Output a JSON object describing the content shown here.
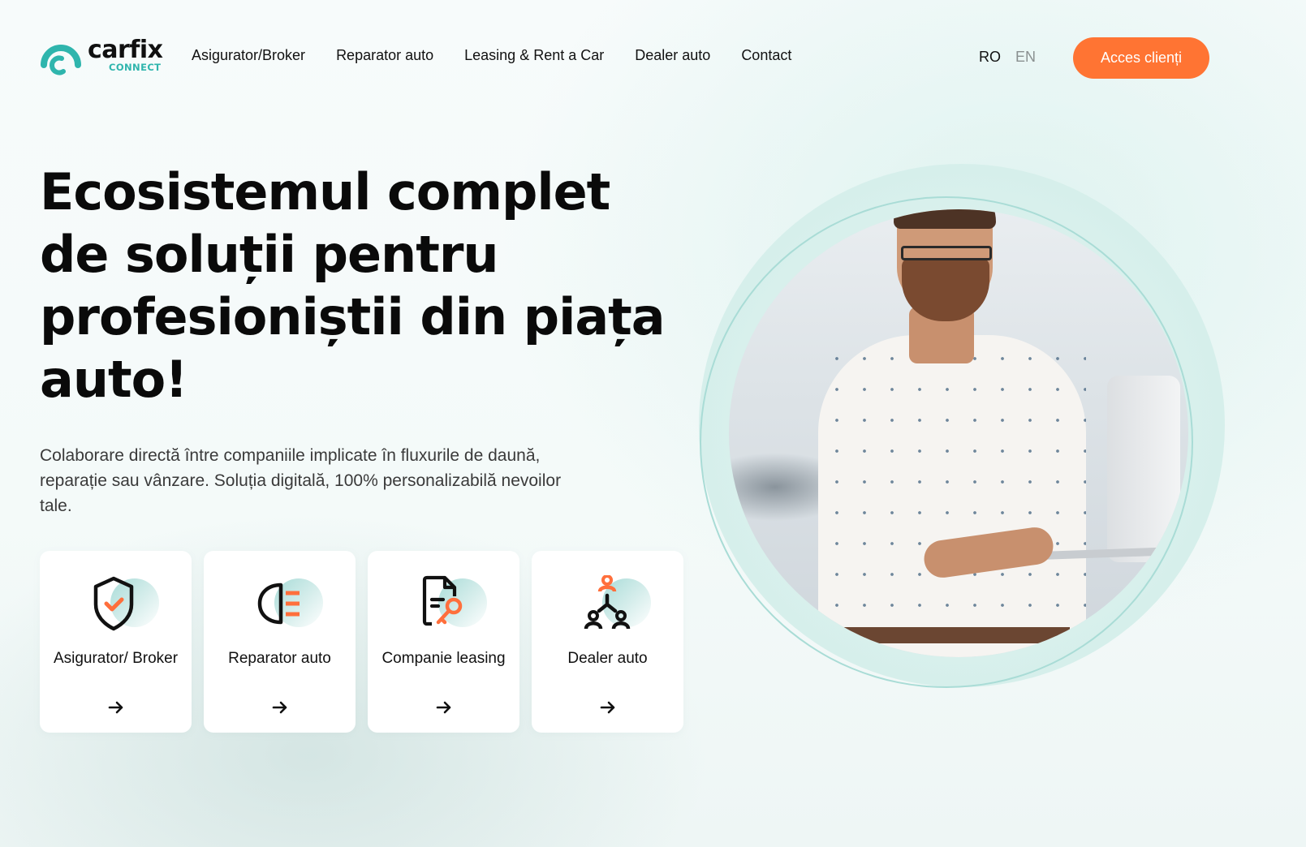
{
  "brand": {
    "name": "carfix",
    "subtitle": "CONNECT",
    "accent_color": "#2fb5ad",
    "cta_color": "#ff7433"
  },
  "nav": {
    "items": [
      {
        "label": "Asigurator/Broker"
      },
      {
        "label": "Reparator auto"
      },
      {
        "label": "Leasing & Rent a Car"
      },
      {
        "label": "Dealer auto"
      },
      {
        "label": "Contact"
      }
    ]
  },
  "language": {
    "options": [
      "RO",
      "EN"
    ],
    "selected": "RO"
  },
  "header": {
    "cta_label": "Acces clienți"
  },
  "hero": {
    "title": "Ecosistemul complet de soluții pentru profesioniștii din piața auto!",
    "subtitle": "Colaborare directă între companiile implicate în fluxurile de daună, reparație sau vânzare. Soluția digitală, 100% personalizabilă nevoilor tale.",
    "image_alt": "man-holding-laptop-portrait"
  },
  "cards": [
    {
      "label": "Asigurator/ Broker",
      "icon": "shield-check-icon"
    },
    {
      "label": "Reparator auto",
      "icon": "headlight-icon"
    },
    {
      "label": "Companie leasing",
      "icon": "document-key-icon"
    },
    {
      "label": "Dealer auto",
      "icon": "network-people-icon"
    }
  ]
}
